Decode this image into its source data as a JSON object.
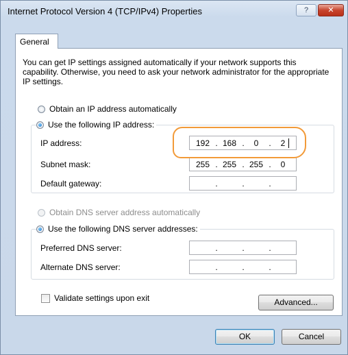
{
  "window": {
    "title": "Internet Protocol Version 4 (TCP/IPv4) Properties",
    "help_glyph": "?",
    "close_glyph": "✕"
  },
  "tabs": [
    {
      "label": "General",
      "active": true
    }
  ],
  "description": "You can get IP settings assigned automatically if your network supports this capability. Otherwise, you need to ask your network administrator for the appropriate IP settings.",
  "ip_mode": {
    "auto_label": "Obtain an IP address automatically",
    "manual_label": "Use the following IP address:",
    "selected": "manual"
  },
  "ip_fields": [
    {
      "label": "IP address:",
      "octets": [
        "192",
        "168",
        "0",
        "2"
      ]
    },
    {
      "label": "Subnet mask:",
      "octets": [
        "255",
        "255",
        "255",
        "0"
      ]
    },
    {
      "label": "Default gateway:",
      "octets": [
        "",
        "",
        "",
        ""
      ]
    }
  ],
  "dns_mode": {
    "auto_label": "Obtain DNS server address automatically",
    "manual_label": "Use the following DNS server addresses:",
    "selected": "manual"
  },
  "dns_fields": [
    {
      "label": "Preferred DNS server:",
      "octets": [
        "",
        "",
        "",
        ""
      ]
    },
    {
      "label": "Alternate DNS server:",
      "octets": [
        "",
        "",
        "",
        ""
      ]
    }
  ],
  "validate": {
    "label": "Validate settings upon exit",
    "checked": false
  },
  "buttons": {
    "advanced": "Advanced...",
    "ok": "OK",
    "cancel": "Cancel"
  },
  "colors": {
    "highlight": "#f29a38",
    "selected_radio": "#1b6bc4"
  }
}
